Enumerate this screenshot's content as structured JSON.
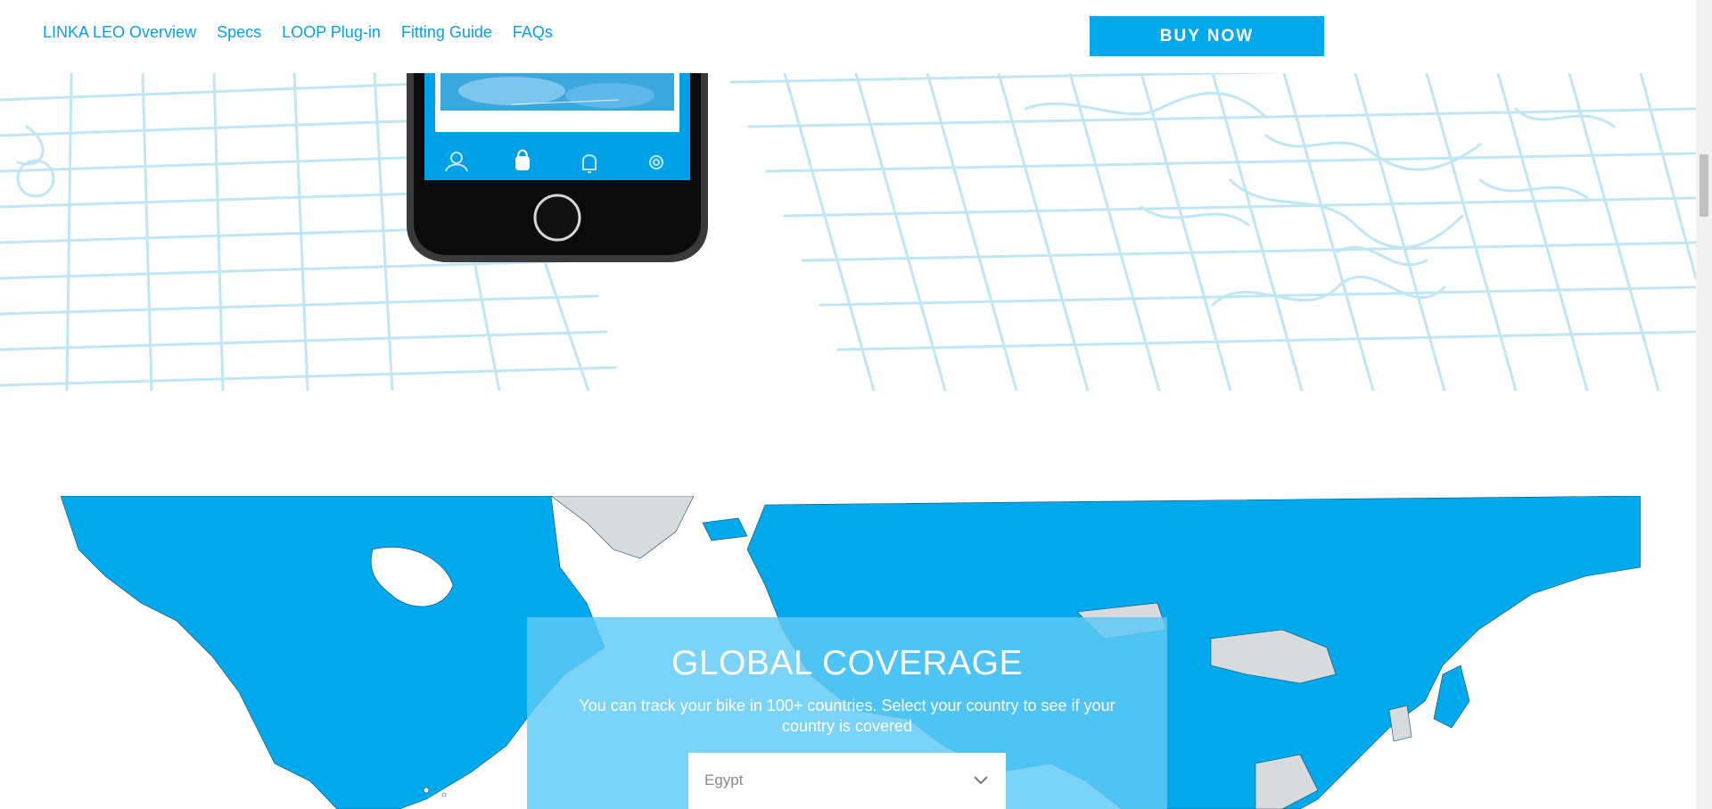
{
  "nav": {
    "links": [
      "LINKA LEO Overview",
      "Specs",
      "LOOP Plug-in",
      "Fitting Guide",
      "FAQs"
    ],
    "buy_label": "BUY NOW"
  },
  "coverage": {
    "title": "GLOBAL COVERAGE",
    "text": "You can track your bike in 100+ countries. Select your country to see if your country is covered",
    "selected_country": "Egypt"
  },
  "colors": {
    "brand_blue": "#00a9ec",
    "nav_link": "#0a9fe3",
    "street_lines": "#bfe6f5",
    "uncovered_land": "#d7dbde"
  },
  "icons": [
    "profile-icon",
    "lock-icon",
    "bell-icon",
    "gear-icon",
    "home-button-icon",
    "chevron-down-icon",
    "scrollbar-thumb"
  ]
}
